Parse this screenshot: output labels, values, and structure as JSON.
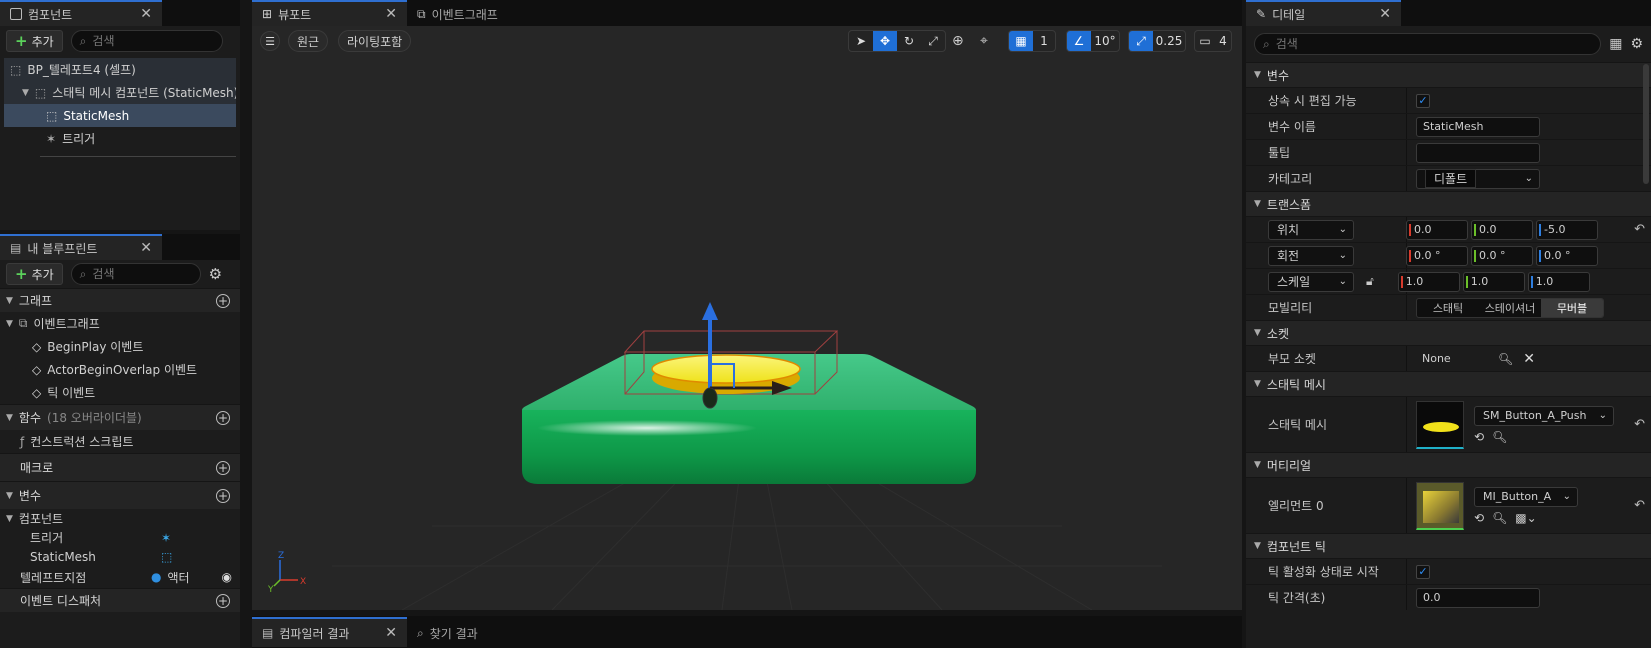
{
  "components_panel": {
    "tab_label": "컴포넌트",
    "add_label": "추가",
    "search_placeholder": "검색",
    "tree": [
      {
        "label": "BP_텔레포트4 (셀프)"
      },
      {
        "label": "스태틱 메시 컴포넌트 (StaticMesh)"
      },
      {
        "label": "StaticMesh"
      },
      {
        "label": "트리거"
      }
    ]
  },
  "blueprint_panel": {
    "tab_label": "내 블루프린트",
    "add_label": "추가",
    "search_placeholder": "검색",
    "graph_section": "그래프",
    "event_graph": "이벤트그래프",
    "events": [
      "BeginPlay 이벤트",
      "ActorBeginOverlap 이벤트",
      "틱 이벤트"
    ],
    "functions_section": "함수",
    "functions_sub": "(18 오버라이더블)",
    "construction_script": "컨스트럭션 스크립트",
    "macros_section": "매크로",
    "variables_section": "변수",
    "components_group": "컴포넌트",
    "variables": [
      {
        "name": "트리거",
        "type_icon": "trigger-icon"
      },
      {
        "name": "StaticMesh",
        "type_icon": "static-mesh-icon"
      },
      {
        "name": "텔레프트지점",
        "type": "액터"
      }
    ],
    "event_dispatchers": "이벤트 디스패처"
  },
  "viewport": {
    "tab_label": "뷰포트",
    "event_graph_tab": "이벤트그래프",
    "perspective_btn": "원근",
    "lighting_btn": "라이팅포함",
    "grid_snap": "1",
    "rotation_snap": "10°",
    "scale_snap": "0.25",
    "camera_speed": "4",
    "colors": {
      "base": "#2fae6a",
      "button": "#f2e21a"
    }
  },
  "bottom_tabs": {
    "compile_results": "컴파일러 결과",
    "find_results": "찾기 결과"
  },
  "details": {
    "tab_label": "디테일",
    "search_placeholder": "검색",
    "variable_section": "변수",
    "editable_when_inherited_label": "상속 시 편집 가능",
    "variable_name_label": "변수 이름",
    "variable_name_value": "StaticMesh",
    "tooltip_label": "툴팁",
    "tooltip_value": "",
    "category_label": "카테고리",
    "category_value": "디폴트",
    "transform_section": "트랜스폼",
    "location_label": "위치",
    "location": [
      "0.0",
      "0.0",
      "-5.0"
    ],
    "rotation_label": "회전",
    "rotation": [
      "0.0 °",
      "0.0 °",
      "0.0 °"
    ],
    "scale_label": "스케일",
    "scale": [
      "1.0",
      "1.0",
      "1.0"
    ],
    "mobility_label": "모빌리티",
    "mobility_options": [
      "스태틱",
      "스테이셔너",
      "무버블"
    ],
    "mobility_selected": "무버블",
    "sockets_section": "소켓",
    "parent_socket_label": "부모 소켓",
    "parent_socket_value": "None",
    "static_mesh_section": "스태틱 메시",
    "static_mesh_label": "스태틱 메시",
    "static_mesh_value": "SM_Button_A_Push",
    "materials_section": "머티리얼",
    "element0_label": "엘리먼트 0",
    "element0_value": "MI_Button_A",
    "component_tick_section": "컴포넌트 틱",
    "start_tick_enabled_label": "틱 활성화 상태로 시작",
    "tick_interval_label": "틱 간격(초)",
    "tick_interval_value": "0.0"
  }
}
